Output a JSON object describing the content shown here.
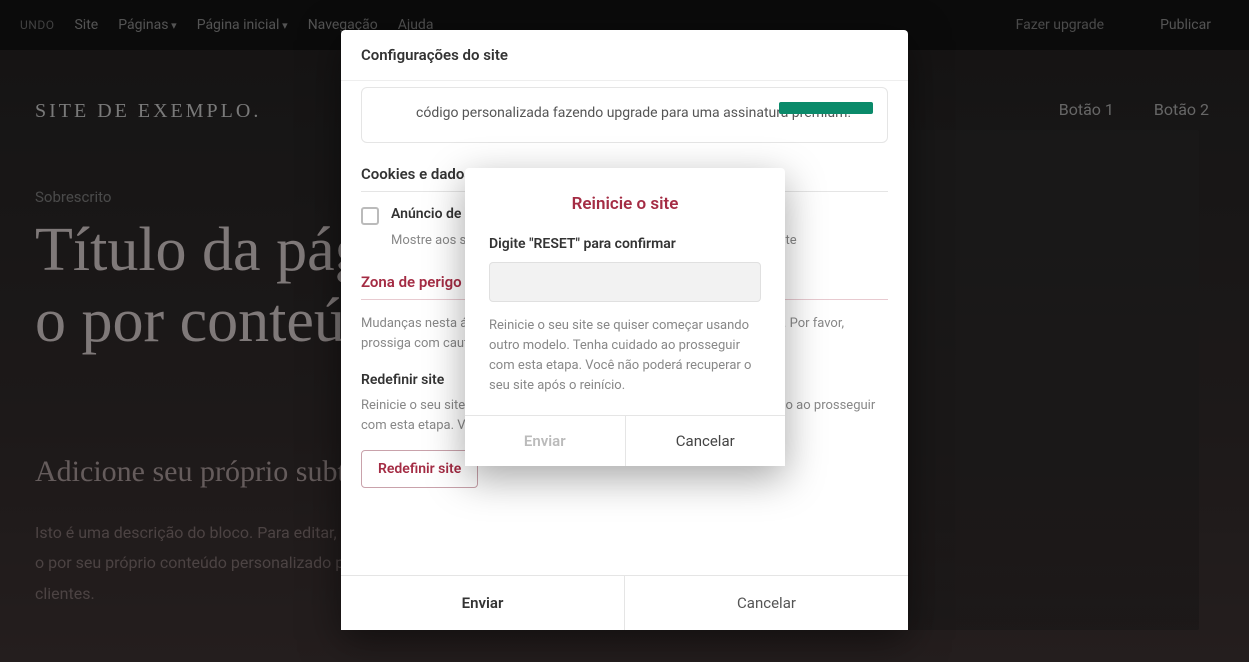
{
  "topbar": {
    "undo": "UNDO",
    "site": "Site",
    "pages": "Páginas",
    "home": "Página inicial",
    "nav": "Navegação",
    "help": "Ajuda",
    "upgrade": "Fazer upgrade",
    "publish": "Publicar"
  },
  "page": {
    "site_title": "SITE DE EXEMPLO.",
    "nav_btn1": "Botão 1",
    "nav_btn2": "Botão 2",
    "overline": "Sobrescrito",
    "hero": "Título da página Substitua-o por conteúdo próprio",
    "subtitle": "Adicione seu próprio subtítulo aqui",
    "desc": "Isto é uma descrição do bloco. Para editar, clique e digite o texto ou substitua-o por seu próprio conteúdo personalizado para converter visitantes do site em clientes."
  },
  "settings": {
    "title": "Configurações do site",
    "promo_text": "código personalizada fazendo upgrade para uma assinatura premium!",
    "cookies_section": "Cookies e dados",
    "cookie_notice_label": "Anúncio de cookies",
    "cookie_notice_sub": "Mostre aos seus visitantes uma mensagem sobre cookies em seu site",
    "danger_section": "Zona de perigo",
    "danger_desc": "Mudanças nesta área podem resultar em alterações permanentes no site. Por favor, prossiga com cautela.",
    "reset_heading": "Redefinir site",
    "reset_desc": "Reinicie o seu site se quiser começar usando outro modelo. Tenha cuidado ao prosseguir com esta etapa. Você não poderá recuperar o seu site após o reinício.",
    "reset_button": "Redefinir site",
    "submit": "Enviar",
    "cancel": "Cancelar"
  },
  "confirm": {
    "title": "Reinicie o site",
    "label": "Digite \"RESET\" para confirmar",
    "input_value": "",
    "desc": "Reinicie o seu site se quiser começar usando outro modelo. Tenha cuidado ao prosseguir com esta etapa. Você não poderá recuperar o seu site após o reinício.",
    "submit": "Enviar",
    "cancel": "Cancelar"
  }
}
